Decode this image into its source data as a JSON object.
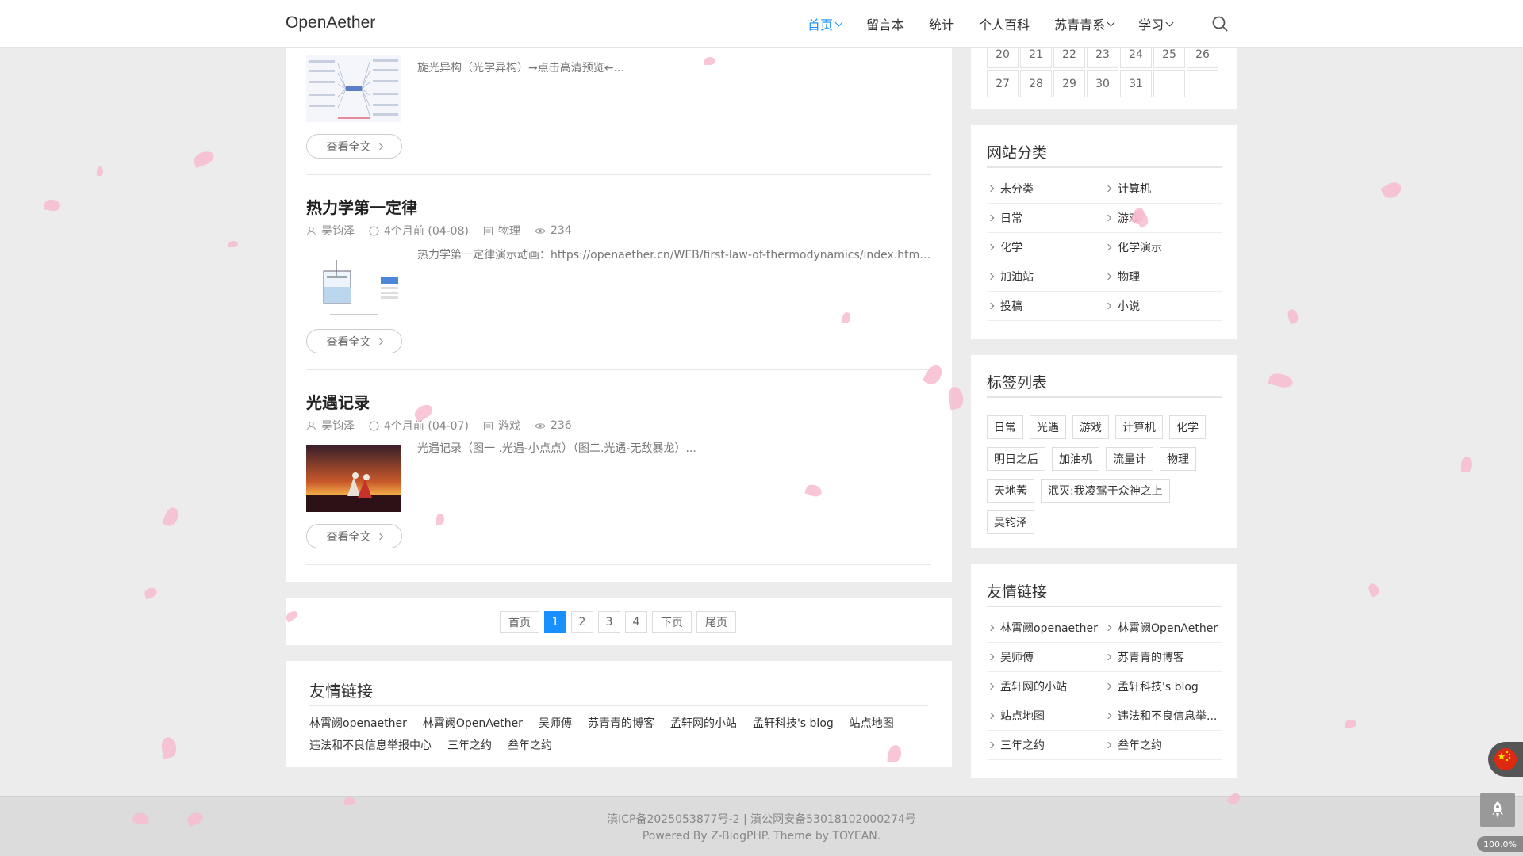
{
  "site": {
    "logo": "OpenAether"
  },
  "nav": {
    "items": [
      {
        "label": "首页",
        "dropdown": true,
        "active": true
      },
      {
        "label": "留言本",
        "dropdown": false
      },
      {
        "label": "统计",
        "dropdown": false
      },
      {
        "label": "个人百科",
        "dropdown": false
      },
      {
        "label": "苏青青系",
        "dropdown": true
      },
      {
        "label": "学习",
        "dropdown": true
      }
    ]
  },
  "posts": [
    {
      "excerpt": "旋光异构（光学异构）→点击高清预览←...",
      "read_more": "查看全文"
    },
    {
      "title": "热力学第一定律",
      "author": "吴钧泽",
      "time": "4个月前 (04-08)",
      "category": "物理",
      "views": "234",
      "excerpt": "热力学第一定律演示动画：https://openaether.cn/WEB/first-law-of-thermodynamics/index.html...",
      "read_more": "查看全文"
    },
    {
      "title": "光遇记录",
      "author": "吴钧泽",
      "time": "4个月前 (04-07)",
      "category": "游戏",
      "views": "236",
      "excerpt": "光遇记录（图一 .光遇-小点点）（图二.光遇-无敌暴龙）...",
      "read_more": "查看全文"
    }
  ],
  "pagination": {
    "first": "首页",
    "pages": [
      "1",
      "2",
      "3",
      "4"
    ],
    "next": "下页",
    "last": "尾页",
    "current": "1"
  },
  "friend_links_bottom": {
    "title": "友情链接",
    "row1": [
      "林霄阙openaether",
      "林霄阙OpenAether",
      "吴师傅",
      "苏青青的博客",
      "孟轩网的小站",
      "孟轩科技's blog",
      "站点地图"
    ],
    "row2": [
      "违法和不良信息举报中心",
      "三年之约",
      "叁年之约"
    ]
  },
  "calendar": {
    "rows": [
      [
        "20",
        "21",
        "22",
        "23",
        "24",
        "25",
        "26"
      ],
      [
        "27",
        "28",
        "29",
        "30",
        "31",
        "",
        ""
      ]
    ]
  },
  "categories": {
    "title": "网站分类",
    "items": [
      "未分类",
      "计算机",
      "日常",
      "游戏",
      "化学",
      "化学演示",
      "加油站",
      "物理",
      "投稿",
      "小说"
    ]
  },
  "tags": {
    "title": "标签列表",
    "items": [
      "日常",
      "光遇",
      "游戏",
      "计算机",
      "化学",
      "明日之后",
      "加油机",
      "流量计",
      "物理",
      "天地莠",
      "泯灭:我凌驾于众神之上",
      "吴钧泽"
    ]
  },
  "friend_links_side": {
    "title": "友情链接",
    "items": [
      "林霄阙openaether",
      "林霄阙OpenAether",
      "吴师傅",
      "苏青青的博客",
      "孟轩网的小站",
      "孟轩科技's blog",
      "站点地图",
      "违法和不良信息举...",
      "三年之约",
      "叁年之约"
    ]
  },
  "footer": {
    "icp": "滇ICP备2025053877号-2 | 滇公网安备53018102000274号",
    "powered": "Powered By Z-BlogPHP. Theme by TOYEAN."
  },
  "widgets": {
    "zoom": "100.0%"
  },
  "colors": {
    "accent": "#1890ff",
    "petal": "#f7bcd0",
    "background": "#ececec"
  }
}
